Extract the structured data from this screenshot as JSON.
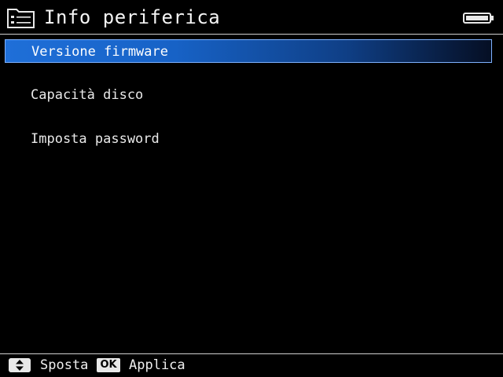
{
  "header": {
    "title": "Info periferica",
    "icon": "folder-settings-icon",
    "battery_icon": "battery-full-icon"
  },
  "menu": {
    "items": [
      {
        "label": "Versione firmware",
        "selected": true
      },
      {
        "label": "Capacità disco",
        "selected": false
      },
      {
        "label": "Imposta password",
        "selected": false
      }
    ]
  },
  "footer": {
    "move_icon": "up-down-arrows-icon",
    "move_label": "Sposta",
    "ok_badge": "OK",
    "apply_label": "Applica"
  },
  "colors": {
    "background": "#000000",
    "selection": "#1f6fd8",
    "text": "#f2f2f2"
  }
}
